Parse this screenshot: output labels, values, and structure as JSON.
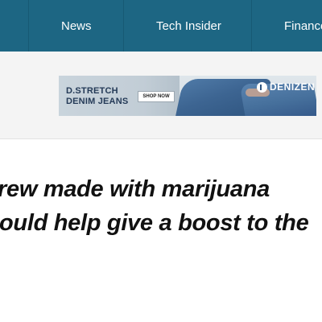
{
  "nav": {
    "items": [
      {
        "label": "News"
      },
      {
        "label": "Tech Insider"
      },
      {
        "label": "Finance"
      }
    ]
  },
  "ad": {
    "brand_line1": "D.STRETCH",
    "brand_line2": "DENIM JEANS",
    "cta_label": "SHOP NOW",
    "logo_text": "DENIZEN",
    "icon": "denizen-logo-icon"
  },
  "article": {
    "headline_line1": "rew made with marijuana",
    "headline_line2": "ould help give a boost to the"
  },
  "colors": {
    "nav_background": "#1d6683",
    "nav_text": "#ffffff",
    "ad_strip_background": "#f4f4f4",
    "headline_text": "#111111"
  }
}
